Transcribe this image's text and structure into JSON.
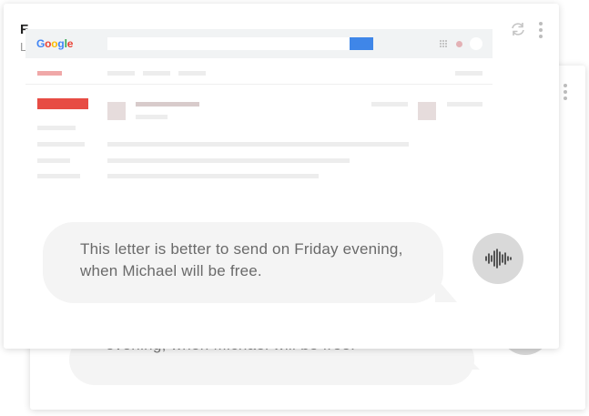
{
  "back_card": {
    "bubble_text": "evening, when Michael will be free."
  },
  "front_card": {
    "peek_title": "F",
    "peek_subtitle": "L",
    "mock_email": {
      "logo_letters": [
        {
          "char": "G",
          "color": "#4285f4"
        },
        {
          "char": "o",
          "color": "#ea4335"
        },
        {
          "char": "o",
          "color": "#fbbc05"
        },
        {
          "char": "g",
          "color": "#4285f4"
        },
        {
          "char": "l",
          "color": "#34a853"
        },
        {
          "char": "e",
          "color": "#ea4335"
        }
      ],
      "search_button_color": "#3f86e8",
      "compose_button_color": "#e74c44"
    },
    "message_bubble": {
      "text": "This letter is better to send on Friday evening, when Michael will be free."
    },
    "icons": {
      "refresh": "refresh-icon",
      "menu": "more-vert-icon",
      "voice": "sound-wave-icon"
    }
  },
  "colors": {
    "bubble_bg": "#f4f4f4",
    "voice_button_bg": "#d9d9d9",
    "text": "#6a6a6a"
  }
}
